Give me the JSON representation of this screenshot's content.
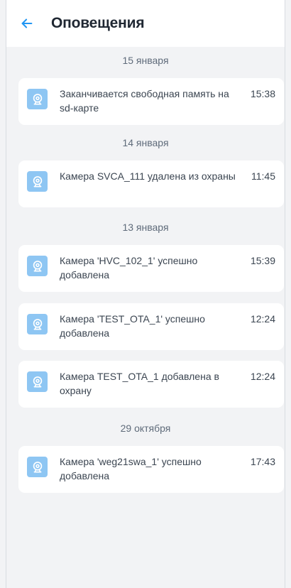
{
  "header": {
    "title": "Оповещения",
    "back_icon": "arrow-left-icon"
  },
  "colors": {
    "accent": "#2196f3",
    "icon_background": "#8ec6f3",
    "screen_background": "#f2f3f5",
    "card_background": "#ffffff"
  },
  "groups": [
    {
      "date": "15 января",
      "items": [
        {
          "icon": "camera-icon",
          "text": "Заканчивается свободная память на sd-карте",
          "time": "15:38"
        }
      ]
    },
    {
      "date": "14 января",
      "items": [
        {
          "icon": "camera-icon",
          "text": "Камера SVCA_111 удалена из охраны",
          "time": "11:45"
        }
      ]
    },
    {
      "date": "13 января",
      "items": [
        {
          "icon": "camera-icon",
          "text": "Камера 'HVC_102_1' успешно добавлена",
          "time": "15:39"
        },
        {
          "icon": "camera-icon",
          "text": "Камера 'TEST_OTA_1' успешно добавлена",
          "time": "12:24"
        },
        {
          "icon": "camera-icon",
          "text": "Камера TEST_OTA_1 добавлена в охрану",
          "time": "12:24"
        }
      ]
    },
    {
      "date": "29 октября",
      "items": [
        {
          "icon": "camera-icon",
          "text": "Камера 'weg21swa_1' успешно добавлена",
          "time": "17:43"
        }
      ]
    }
  ]
}
